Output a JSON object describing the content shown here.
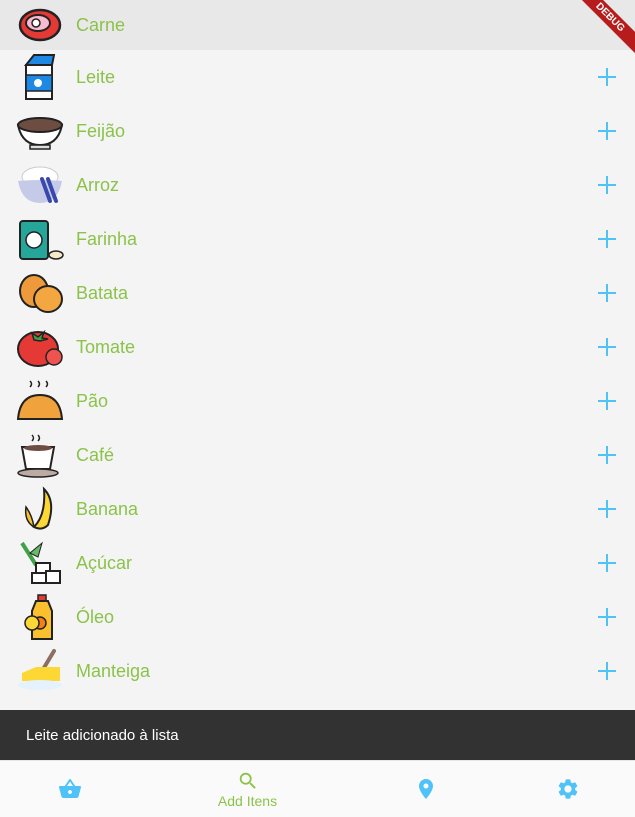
{
  "items": [
    {
      "name": "Carne",
      "icon": "meat-icon"
    },
    {
      "name": "Leite",
      "icon": "milk-icon"
    },
    {
      "name": "Feijão",
      "icon": "beans-icon"
    },
    {
      "name": "Arroz",
      "icon": "rice-icon"
    },
    {
      "name": "Farinha",
      "icon": "flour-icon"
    },
    {
      "name": "Batata",
      "icon": "potato-icon"
    },
    {
      "name": "Tomate",
      "icon": "tomato-icon"
    },
    {
      "name": "Pão",
      "icon": "bread-icon"
    },
    {
      "name": "Café",
      "icon": "coffee-icon"
    },
    {
      "name": "Banana",
      "icon": "banana-icon"
    },
    {
      "name": "Açúcar",
      "icon": "sugar-icon"
    },
    {
      "name": "Óleo",
      "icon": "oil-icon"
    },
    {
      "name": "Manteiga",
      "icon": "butter-icon"
    }
  ],
  "debug_banner": "DEBUG",
  "snackbar": {
    "message": "Leite adicionado à lista"
  },
  "bottom_nav": {
    "active_label": "Add Itens"
  },
  "colors": {
    "accent_green": "#8bc34a",
    "accent_blue": "#4fc3f7",
    "snackbar_bg": "#323232"
  }
}
